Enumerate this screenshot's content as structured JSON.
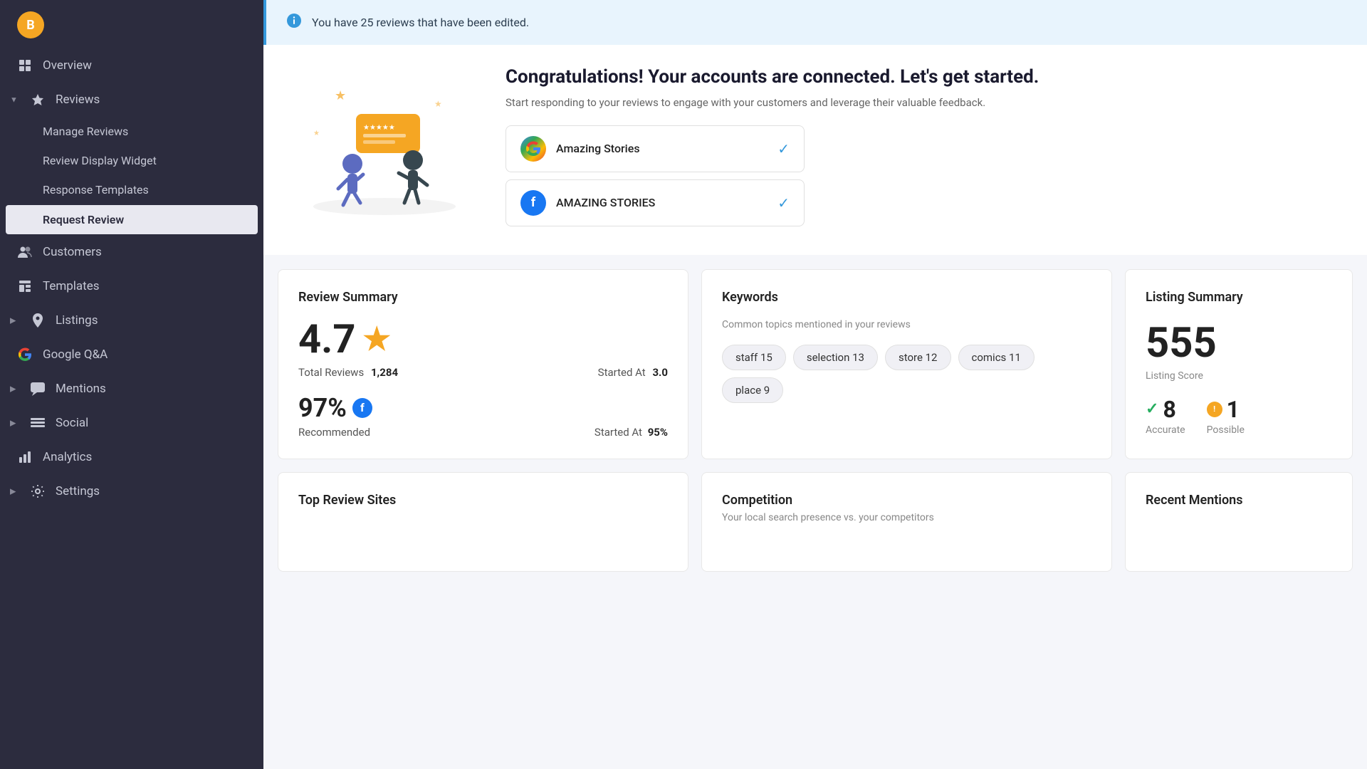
{
  "sidebar": {
    "logo_text": "B",
    "items": [
      {
        "id": "overview",
        "label": "Overview",
        "icon": "grid",
        "expanded": false,
        "active": false
      },
      {
        "id": "reviews",
        "label": "Reviews",
        "icon": "star",
        "expanded": true,
        "active": true
      },
      {
        "id": "customers",
        "label": "Customers",
        "icon": "people",
        "expanded": false,
        "active": false
      },
      {
        "id": "templates",
        "label": "Templates",
        "icon": "template",
        "expanded": false,
        "active": false
      },
      {
        "id": "listings",
        "label": "Listings",
        "icon": "location",
        "expanded": false,
        "active": false
      },
      {
        "id": "google-qa",
        "label": "Google Q&A",
        "icon": "google",
        "expanded": false,
        "active": false
      },
      {
        "id": "mentions",
        "label": "Mentions",
        "icon": "chat",
        "expanded": false,
        "active": false
      },
      {
        "id": "social",
        "label": "Social",
        "icon": "social",
        "expanded": false,
        "active": false
      },
      {
        "id": "analytics",
        "label": "Analytics",
        "icon": "chart",
        "expanded": false,
        "active": false
      },
      {
        "id": "settings",
        "label": "Settings",
        "icon": "gear",
        "expanded": false,
        "active": false
      }
    ],
    "sub_items": [
      {
        "id": "manage-reviews",
        "label": "Manage Reviews",
        "active": false
      },
      {
        "id": "review-display-widget",
        "label": "Review Display Widget",
        "active": false
      },
      {
        "id": "response-templates",
        "label": "Response Templates",
        "active": false
      },
      {
        "id": "request-review",
        "label": "Request Review",
        "active": true
      }
    ]
  },
  "alert": {
    "text": "You have 25 reviews that have been edited."
  },
  "congrats": {
    "title": "Congratulations! Your accounts are connected. Let's get started.",
    "subtitle": "Start responding to your reviews to engage with your customers and leverage their valuable feedback.",
    "accounts": [
      {
        "id": "google",
        "name": "Amazing Stories",
        "type": "google",
        "connected": true
      },
      {
        "id": "facebook",
        "name": "AMAZING STORIES",
        "type": "facebook",
        "connected": true
      }
    ]
  },
  "review_summary": {
    "title": "Review Summary",
    "rating": "4.7",
    "total_reviews_label": "Total Reviews",
    "total_reviews_value": "1,284",
    "started_at_label": "Started At",
    "started_at_value": "3.0",
    "recommend_percent": "97%",
    "recommend_label": "Recommended",
    "started_at_2_label": "Started At",
    "started_at_2_value": "95%"
  },
  "keywords": {
    "title": "Keywords",
    "desc": "Common topics mentioned in your reviews",
    "tags": [
      {
        "label": "staff 15"
      },
      {
        "label": "selection 13"
      },
      {
        "label": "store 12"
      },
      {
        "label": "comics 11"
      },
      {
        "label": "place 9"
      }
    ]
  },
  "listing_summary": {
    "title": "Listing Summary",
    "score": "555",
    "score_label": "Listing Score",
    "accurate_num": "8",
    "accurate_label": "Accurate",
    "possible_num": "1",
    "possible_label": "Possible"
  },
  "bottom_cards": [
    {
      "id": "top-review-sites",
      "title": "Top Review Sites",
      "subtitle": ""
    },
    {
      "id": "competition",
      "title": "Competition",
      "subtitle": "Your local search presence vs. your competitors"
    },
    {
      "id": "recent-mentions",
      "title": "Recent Mentions",
      "subtitle": ""
    }
  ]
}
